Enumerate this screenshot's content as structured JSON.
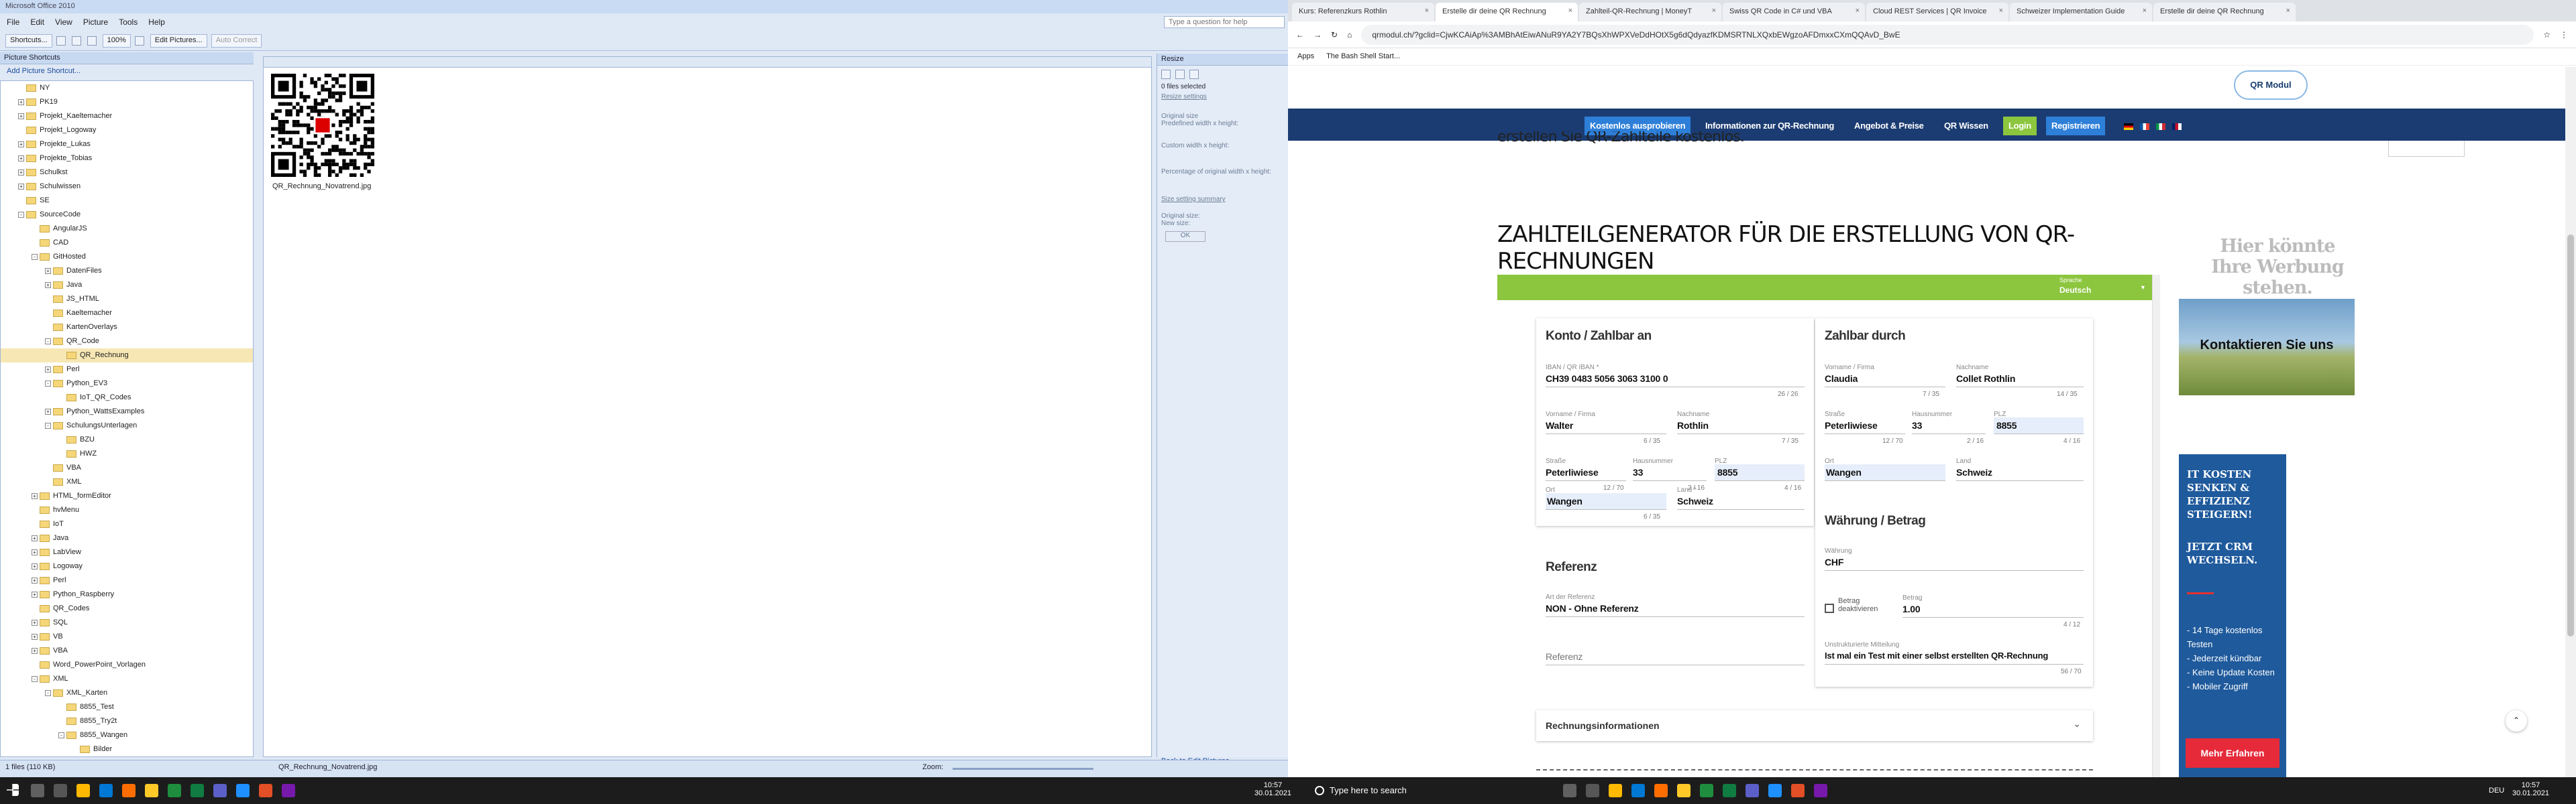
{
  "office": {
    "title": "Microsoft Office 2010",
    "menu": [
      "File",
      "Edit",
      "View",
      "Picture",
      "Tools",
      "Help"
    ],
    "help_placeholder": "Type a question for help",
    "toolbar": {
      "shortcuts": "Shortcuts...",
      "zoom": "100%",
      "edit": "Edit Pictures...",
      "autocorrect": "Auto Correct"
    },
    "panel_title": "Picture Shortcuts",
    "add_shortcut": "Add Picture Shortcut...",
    "tree": [
      {
        "l": "NY",
        "d": 1,
        "s": ""
      },
      {
        "l": "PK19",
        "d": 1,
        "s": "+"
      },
      {
        "l": "Projekt_Kaeltemacher",
        "d": 1,
        "s": "+"
      },
      {
        "l": "Projekt_Logoway",
        "d": 1,
        "s": ""
      },
      {
        "l": "Projekte_Lukas",
        "d": 1,
        "s": "+"
      },
      {
        "l": "Projekte_Tobias",
        "d": 1,
        "s": "+"
      },
      {
        "l": "Schulkst",
        "d": 1,
        "s": "+"
      },
      {
        "l": "Schulwissen",
        "d": 1,
        "s": "+"
      },
      {
        "l": "SE",
        "d": 1,
        "s": ""
      },
      {
        "l": "SourceCode",
        "d": 1,
        "s": "-"
      },
      {
        "l": "AngularJS",
        "d": 2,
        "s": ""
      },
      {
        "l": "CAD",
        "d": 2,
        "s": ""
      },
      {
        "l": "GitHosted",
        "d": 2,
        "s": "-"
      },
      {
        "l": "DatenFiles",
        "d": 3,
        "s": "+"
      },
      {
        "l": "Java",
        "d": 3,
        "s": "+"
      },
      {
        "l": "JS_HTML",
        "d": 3,
        "s": ""
      },
      {
        "l": "Kaeltemacher",
        "d": 3,
        "s": ""
      },
      {
        "l": "KartenOverlays",
        "d": 3,
        "s": ""
      },
      {
        "l": "QR_Code",
        "d": 3,
        "s": "-"
      },
      {
        "l": "QR_Rechnung",
        "d": 4,
        "s": "",
        "sel": true
      },
      {
        "l": "Perl",
        "d": 3,
        "s": "+"
      },
      {
        "l": "Python_EV3",
        "d": 3,
        "s": "-"
      },
      {
        "l": "IoT_QR_Codes",
        "d": 4,
        "s": ""
      },
      {
        "l": "Python_WattsExamples",
        "d": 3,
        "s": "+"
      },
      {
        "l": "SchulungsUnterlagen",
        "d": 3,
        "s": "-"
      },
      {
        "l": "BZU",
        "d": 4,
        "s": ""
      },
      {
        "l": "HWZ",
        "d": 4,
        "s": ""
      },
      {
        "l": "VBA",
        "d": 3,
        "s": ""
      },
      {
        "l": "XML",
        "d": 3,
        "s": ""
      },
      {
        "l": "HTML_formEditor",
        "d": 2,
        "s": "+"
      },
      {
        "l": "hvMenu",
        "d": 2,
        "s": ""
      },
      {
        "l": "IoT",
        "d": 2,
        "s": ""
      },
      {
        "l": "Java",
        "d": 2,
        "s": "+"
      },
      {
        "l": "LabView",
        "d": 2,
        "s": "+"
      },
      {
        "l": "Logoway",
        "d": 2,
        "s": "+"
      },
      {
        "l": "Perl",
        "d": 2,
        "s": "+"
      },
      {
        "l": "Python_Raspberry",
        "d": 2,
        "s": "+"
      },
      {
        "l": "QR_Codes",
        "d": 2,
        "s": ""
      },
      {
        "l": "SQL",
        "d": 2,
        "s": "+"
      },
      {
        "l": "VB",
        "d": 2,
        "s": "+"
      },
      {
        "l": "VBA",
        "d": 2,
        "s": "+"
      },
      {
        "l": "Word_PowerPoint_Vorlagen",
        "d": 2,
        "s": ""
      },
      {
        "l": "XML",
        "d": 2,
        "s": "-"
      },
      {
        "l": "XML_Karten",
        "d": 3,
        "s": "-"
      },
      {
        "l": "8855_Test",
        "d": 4,
        "s": ""
      },
      {
        "l": "8855_Try2t",
        "d": 4,
        "s": ""
      },
      {
        "l": "8855_Wangen",
        "d": 4,
        "s": "-"
      },
      {
        "l": "Bilder",
        "d": 5,
        "s": ""
      }
    ],
    "thumb_name": "QR_Rechnung_Novatrend.jpg",
    "resize": {
      "title": "Resize",
      "files": "0 files selected",
      "settings": "Resize settings",
      "o1": "Original size",
      "o2": "Predefined width x height:",
      "o3": "Custom width x height:",
      "o4": "Percentage of original width x height:",
      "summary": "Size setting summary",
      "orig": "Original size:",
      "new": "New size:",
      "ok": "OK",
      "back": "Back to Edit Pictures"
    },
    "status": {
      "files": "1 files (110 KB)",
      "name": "QR_Rechnung_Novatrend.jpg",
      "zoom": "Zoom:"
    }
  },
  "browser": {
    "tabs": [
      "Kurs: Referenzkurs Rothlin",
      "Erstelle dir deine QR Rechnung",
      "Zahlteil-QR-Rechnung | MoneyT",
      "Swiss QR Code in C# und VBA",
      "Cloud REST Services | QR Invoice",
      "Schweizer Implementation Guide",
      "Erstelle dir deine QR Rechnung"
    ],
    "url": "qrmodul.ch/?gclid=CjwKCAiAp%3AMBhAtEiwANuR9YA2Y7BQsXhWPXVeDdHOtX5g6dQdyazfKDMSRTNLXQxbEWgzoAFDmxxCXmQQAvD_BwE",
    "bookmarks": [
      "Apps",
      "The Bash Shell Start..."
    ],
    "logo": "QR Modul",
    "nav": [
      "Kostenlos ausprobieren",
      "Informationen zur QR-Rechnung",
      "Angebot & Preise",
      "QR Wissen",
      "Login",
      "Registrieren"
    ],
    "heading_partial": "erstellen Sie QR-Zahlteile kostenlos.",
    "h1": "ZAHLTEILGENERATOR FÜR DIE ERSTELLUNG VON QR-RECHNUNGEN",
    "lang_label": "Sprache",
    "lang": "Deutsch",
    "konto": {
      "title": "Konto / Zahlbar an",
      "iban_label": "IBAN / QR IBAN *",
      "iban": "CH39 0483 5056 3063 3100 0",
      "iban_cnt": "26 / 26",
      "vorname_l": "Vorname / Firma",
      "vorname": "Walter",
      "vorname_c": "6 / 35",
      "nachname_l": "Nachname",
      "nachname": "Rothlin",
      "nachname_c": "7 / 35",
      "strasse_l": "Straße",
      "strasse": "Peterliwiese",
      "strasse_c": "12 / 70",
      "nr_l": "Hausnummer",
      "nr": "33",
      "nr_c": "2 / 16",
      "plz_l": "PLZ",
      "plz": "8855",
      "plz_c": "4 / 16",
      "ort_l": "Ort",
      "ort": "Wangen",
      "ort_c": "6 / 35",
      "land_l": "Land *",
      "land": "Schweiz"
    },
    "ref": {
      "title": "Referenz",
      "art_l": "Art der Referenz",
      "art": "NON - Ohne Referenz",
      "ref_l": "Referenz"
    },
    "durch": {
      "title": "Zahlbar durch",
      "vorname_l": "Vorname / Firma",
      "vorname": "Claudia",
      "vorname_c": "7 / 35",
      "nachname_l": "Nachname",
      "nachname": "Collet Rothlin",
      "nachname_c": "14 / 35",
      "strasse_l": "Straße",
      "strasse": "Peterliwiese",
      "strasse_c": "12 / 70",
      "nr_l": "Hausnummer",
      "nr": "33",
      "nr_c": "2 / 16",
      "plz_l": "PLZ",
      "plz": "8855",
      "plz_c": "4 / 16",
      "ort_l": "Ort",
      "ort": "Wangen",
      "land_l": "Land",
      "land": "Schweiz"
    },
    "wb": {
      "title": "Währung / Betrag",
      "w_l": "Währung",
      "w": "CHF",
      "dea": "Betrag deaktivieren",
      "b_l": "Betrag",
      "b": "1.00",
      "b_c": "4 / 12",
      "m_l": "Unstrukturierte Mitteilung",
      "m": "Ist mal ein Test mit einer selbst erstellten QR-Rechnung",
      "m_c": "56 / 70"
    },
    "rech": "Rechnungsinformationen",
    "ad1": "Hier könnte Ihre Werbung stehen.",
    "ad2": "Kontaktieren Sie uns",
    "ad3": {
      "t1": "IT KOSTEN SENKEN & EFFIZIENZ STEIGERN!",
      "t2": "JETZT CRM WECHSELN.",
      "bullets": [
        "- 14 Tage kostenlos Testen",
        "- Jederzeit kündbar",
        "- Keine Update Kosten",
        "- Mobiler Zugriff"
      ],
      "btn": "Mehr Erfahren"
    }
  },
  "taskbar": {
    "search": "Type here to search",
    "time": "10:57",
    "date": "30.01.2021",
    "lang": "DEU"
  }
}
